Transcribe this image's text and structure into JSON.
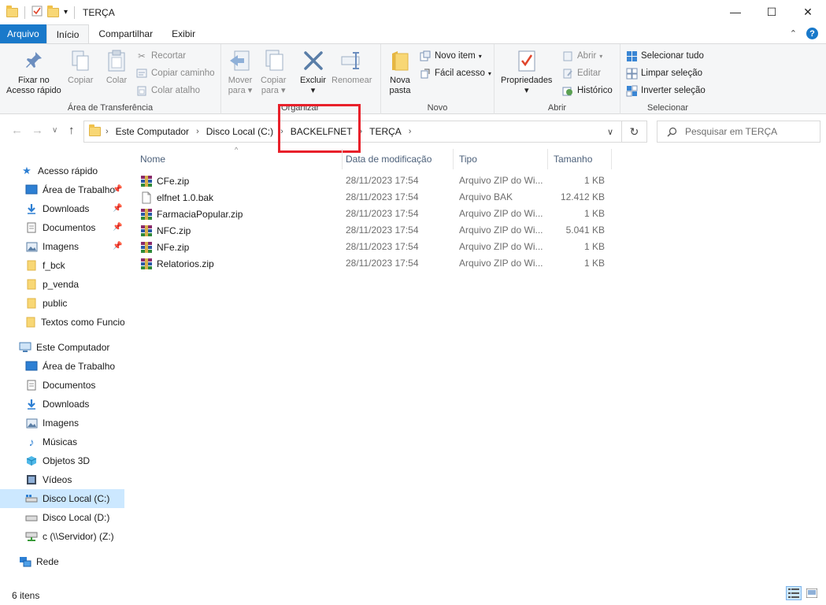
{
  "window": {
    "title": "TERÇA",
    "minimize": "—",
    "maximize": "☐",
    "close": "✕"
  },
  "tabs": [
    {
      "label": "Arquivo"
    },
    {
      "label": "Início"
    },
    {
      "label": "Compartilhar"
    },
    {
      "label": "Exibir"
    }
  ],
  "ribbon": {
    "clipboard": {
      "label": "Área de Transferência",
      "pin_line1": "Fixar no",
      "pin_line2": "Acesso rápido",
      "copy": "Copiar",
      "paste": "Colar",
      "cut": "Recortar",
      "copy_path": "Copiar caminho",
      "paste_shortcut": "Colar atalho"
    },
    "organize": {
      "label": "Organizar",
      "move_line1": "Mover",
      "move_line2": "para",
      "copyto_line1": "Copiar",
      "copyto_line2": "para",
      "delete": "Excluir",
      "rename": "Renomear"
    },
    "new": {
      "label": "Novo",
      "new_folder_line1": "Nova",
      "new_folder_line2": "pasta",
      "new_item": "Novo item",
      "easy_access": "Fácil acesso"
    },
    "open": {
      "label": "Abrir",
      "properties": "Propriedades",
      "open": "Abrir",
      "edit": "Editar",
      "history": "Histórico"
    },
    "select": {
      "label": "Selecionar",
      "select_all": "Selecionar tudo",
      "select_none": "Limpar seleção",
      "invert": "Inverter seleção"
    }
  },
  "address": {
    "crumbs": [
      "Este Computador",
      "Disco Local (C:)",
      "BACKELFNET",
      "TERÇA"
    ],
    "search_placeholder": "Pesquisar em TERÇA"
  },
  "sidebar": {
    "quick_access": "Acesso rápido",
    "quick_items": [
      "Área de Trabalho",
      "Downloads",
      "Documentos",
      "Imagens",
      "f_bck",
      "p_venda",
      "public",
      "Textos como Funcionam"
    ],
    "this_pc": "Este Computador",
    "pc_items": [
      "Área de Trabalho",
      "Documentos",
      "Downloads",
      "Imagens",
      "Músicas",
      "Objetos 3D",
      "Vídeos",
      "Disco Local (C:)",
      "Disco Local (D:)",
      "c (\\\\Servidor) (Z:)"
    ],
    "network": "Rede"
  },
  "columns": {
    "name": "Nome",
    "date": "Data de modificação",
    "type": "Tipo",
    "size": "Tamanho"
  },
  "files": [
    {
      "name": "CFe.zip",
      "date": "28/11/2023 17:54",
      "type": "Arquivo ZIP do Wi...",
      "size": "1 KB",
      "icon": "zip"
    },
    {
      "name": "elfnet 1.0.bak",
      "date": "28/11/2023 17:54",
      "type": "Arquivo BAK",
      "size": "12.412 KB",
      "icon": "file"
    },
    {
      "name": "FarmaciaPopular.zip",
      "date": "28/11/2023 17:54",
      "type": "Arquivo ZIP do Wi...",
      "size": "1 KB",
      "icon": "zip"
    },
    {
      "name": "NFC.zip",
      "date": "28/11/2023 17:54",
      "type": "Arquivo ZIP do Wi...",
      "size": "5.041 KB",
      "icon": "zip"
    },
    {
      "name": "NFe.zip",
      "date": "28/11/2023 17:54",
      "type": "Arquivo ZIP do Wi...",
      "size": "1 KB",
      "icon": "zip"
    },
    {
      "name": "Relatorios.zip",
      "date": "28/11/2023 17:54",
      "type": "Arquivo ZIP do Wi...",
      "size": "1 KB",
      "icon": "zip"
    }
  ],
  "status": {
    "count": "6 itens"
  },
  "colors": {
    "accent": "#1979ca",
    "highlight_box": "#e8202a",
    "selection": "#cce8ff"
  }
}
